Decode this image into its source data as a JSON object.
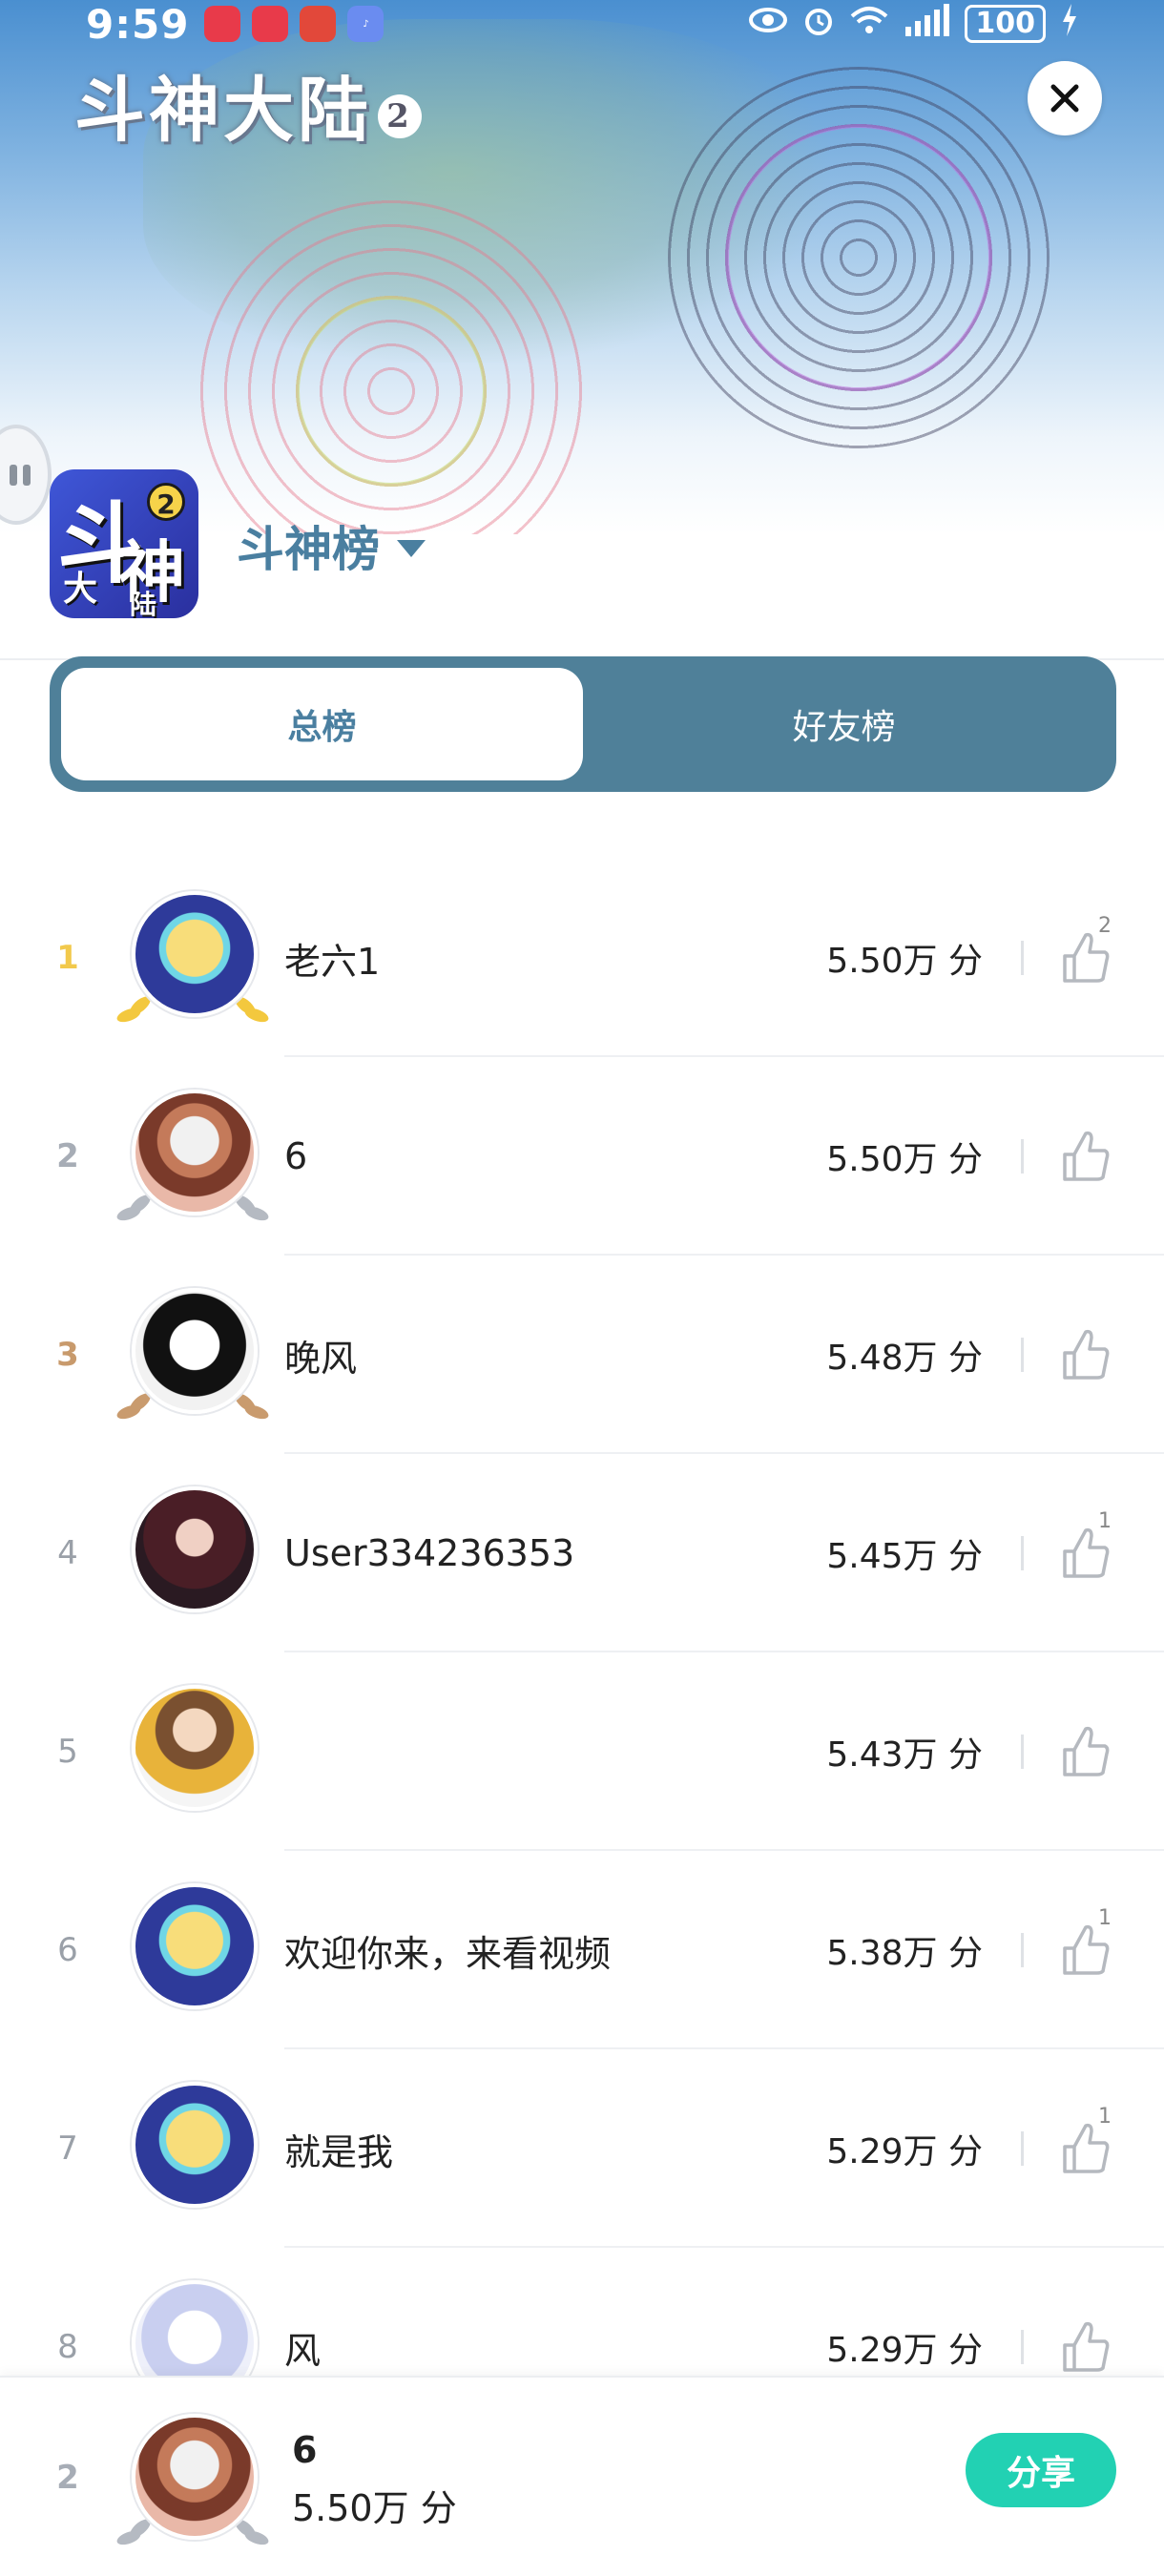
{
  "status_bar": {
    "time": "9:59",
    "battery": "100"
  },
  "banner": {
    "game_title": "斗神大陆",
    "game_title_num": "2"
  },
  "game": {
    "icon_glyph_1": "斗",
    "icon_glyph_2": "神",
    "icon_glyph_3": "大",
    "icon_glyph_4": "陆",
    "icon_badge": "2"
  },
  "board": {
    "title": "斗神榜"
  },
  "tabs": [
    {
      "label": "总榜",
      "active": true
    },
    {
      "label": "好友榜",
      "active": false
    }
  ],
  "ranking": [
    {
      "rank": "1",
      "name": "老六1",
      "score": "5.50万 分",
      "likes": "2"
    },
    {
      "rank": "2",
      "name": "6",
      "score": "5.50万 分",
      "likes": ""
    },
    {
      "rank": "3",
      "name": "晚风",
      "score": "5.48万 分",
      "likes": ""
    },
    {
      "rank": "4",
      "name": "User334236353",
      "score": "5.45万 分",
      "likes": "1"
    },
    {
      "rank": "5",
      "name": "",
      "score": "5.43万 分",
      "likes": ""
    },
    {
      "rank": "6",
      "name": "欢迎你来，来看视频",
      "score": "5.38万 分",
      "likes": "1"
    },
    {
      "rank": "7",
      "name": "就是我",
      "score": "5.29万 分",
      "likes": "1"
    },
    {
      "rank": "8",
      "name": "风",
      "score": "5.29万 分",
      "likes": ""
    }
  ],
  "my_rank": {
    "rank": "2",
    "name": "6",
    "score": "5.50万 分",
    "share_label": "分享"
  },
  "colors": {
    "accent": "#4f8099",
    "share": "#22d1b3",
    "gold": "#f2c94c",
    "silver": "#a7adb6",
    "bronze": "#c89a6c"
  }
}
